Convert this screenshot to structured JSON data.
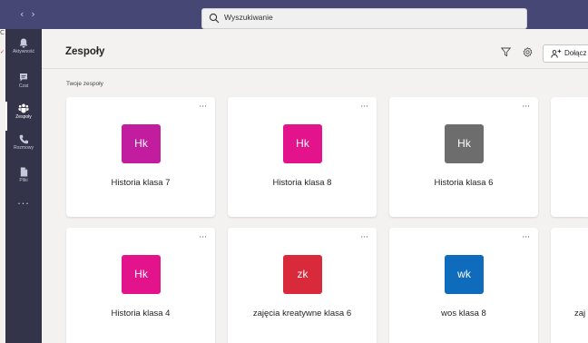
{
  "titlebar": {
    "back_glyph": "‹",
    "forward_glyph": "›",
    "search": {
      "placeholder": "Wyszukiwanie"
    }
  },
  "os_edge": {
    "top_glyph": "C"
  },
  "rail": {
    "items": [
      {
        "label": "Aktywność",
        "icon": "bell-icon"
      },
      {
        "label": "Czat",
        "icon": "chat-icon"
      },
      {
        "label": "Zespoły",
        "icon": "teams-icon",
        "active": true
      },
      {
        "label": "Rozmowy",
        "icon": "phone-icon"
      },
      {
        "label": "Pliki",
        "icon": "file-icon"
      }
    ],
    "more": "···"
  },
  "header": {
    "title": "Zespoły",
    "join_label": "Dołącz"
  },
  "section_label": "Twoje zespoły",
  "card_more": "···",
  "teams": [
    {
      "initials": "Hk",
      "name": "Historia klasa 7",
      "color": "#c21d9f"
    },
    {
      "initials": "Hk",
      "name": "Historia klasa 8",
      "color": "#e3138b"
    },
    {
      "initials": "Hk",
      "name": "Historia klasa 6",
      "color": "#6d6d6d"
    },
    {
      "initials": "Hk",
      "name": "Historia klasa 4",
      "color": "#e3138b"
    },
    {
      "initials": "zk",
      "name": "zajęcia kreatywne klasa 6",
      "color": "#d92a3c"
    },
    {
      "initials": "wk",
      "name": "wos klasa 8",
      "color": "#0f6cbd"
    },
    {
      "initials": "",
      "name": "zaj",
      "color": "#ffffff"
    }
  ],
  "colors": {
    "titlebar": "#464775",
    "rail": "#33344a",
    "background": "#f3f2f1"
  }
}
